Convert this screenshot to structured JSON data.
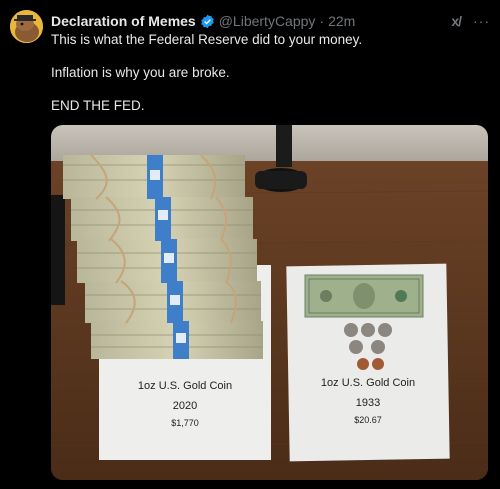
{
  "tweet": {
    "author_name": "Declaration of Memes",
    "handle": "@LibertyCappy",
    "separator": "·",
    "time": "22m",
    "lines": [
      "This is what the Federal Reserve did to your money.",
      "Inflation is why you are broke.",
      "END THE FED."
    ]
  },
  "actions": {
    "grok_label": "x/",
    "more_label": "···"
  },
  "photo": {
    "left_card": {
      "title": "1oz U.S. Gold Coin",
      "year": "2020",
      "price": "$1,770"
    },
    "right_card": {
      "title": "1oz U.S. Gold Coin",
      "year": "1933",
      "price": "$20.67"
    }
  }
}
